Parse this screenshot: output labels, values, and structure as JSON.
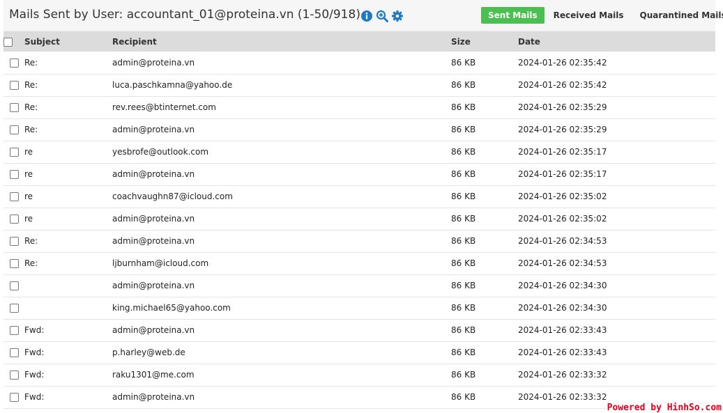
{
  "header": {
    "title": "Mails Sent by User: accountant_01@proteina.vn (1-50/918)",
    "icons": [
      "info-icon",
      "zoom-in-icon",
      "gear-icon"
    ],
    "icon_color": "#1e7bc2"
  },
  "nav": {
    "sent": "Sent Mails",
    "received": "Received Mails",
    "quarantined": "Quarantined Mails",
    "active_color": "#4cbf52"
  },
  "table": {
    "columns": {
      "subject": "Subject",
      "recipient": "Recipient",
      "size": "Size",
      "date": "Date"
    },
    "rows": [
      {
        "subject": "Re:",
        "recipient": "admin@proteina.vn",
        "size": "86 KB",
        "date": "2024-01-26 02:35:42"
      },
      {
        "subject": "Re:",
        "recipient": "luca.paschkamna@yahoo.de",
        "size": "86 KB",
        "date": "2024-01-26 02:35:42"
      },
      {
        "subject": "Re:",
        "recipient": "rev.rees@btinternet.com",
        "size": "86 KB",
        "date": "2024-01-26 02:35:29"
      },
      {
        "subject": "Re:",
        "recipient": "admin@proteina.vn",
        "size": "86 KB",
        "date": "2024-01-26 02:35:29"
      },
      {
        "subject": "re",
        "recipient": "yesbrofe@outlook.com",
        "size": "86 KB",
        "date": "2024-01-26 02:35:17"
      },
      {
        "subject": "re",
        "recipient": "admin@proteina.vn",
        "size": "86 KB",
        "date": "2024-01-26 02:35:17"
      },
      {
        "subject": "re",
        "recipient": "coachvaughn87@icloud.com",
        "size": "86 KB",
        "date": "2024-01-26 02:35:02"
      },
      {
        "subject": "re",
        "recipient": "admin@proteina.vn",
        "size": "86 KB",
        "date": "2024-01-26 02:35:02"
      },
      {
        "subject": "Re:",
        "recipient": "admin@proteina.vn",
        "size": "86 KB",
        "date": "2024-01-26 02:34:53"
      },
      {
        "subject": "Re:",
        "recipient": "ljburnham@icloud.com",
        "size": "86 KB",
        "date": "2024-01-26 02:34:53"
      },
      {
        "subject": "",
        "recipient": "admin@proteina.vn",
        "size": "86 KB",
        "date": "2024-01-26 02:34:30"
      },
      {
        "subject": "",
        "recipient": "king.michael65@yahoo.com",
        "size": "86 KB",
        "date": "2024-01-26 02:34:30"
      },
      {
        "subject": "Fwd:",
        "recipient": "admin@proteina.vn",
        "size": "86 KB",
        "date": "2024-01-26 02:33:43"
      },
      {
        "subject": "Fwd:",
        "recipient": "p.harley@web.de",
        "size": "86 KB",
        "date": "2024-01-26 02:33:43"
      },
      {
        "subject": "Fwd:",
        "recipient": "raku1301@me.com",
        "size": "86 KB",
        "date": "2024-01-26 02:33:32"
      },
      {
        "subject": "Fwd:",
        "recipient": "admin@proteina.vn",
        "size": "86 KB",
        "date": "2024-01-26 02:33:32"
      }
    ]
  },
  "watermark": {
    "text": "Powered by HinhSo.com",
    "color": "#e0001b"
  }
}
